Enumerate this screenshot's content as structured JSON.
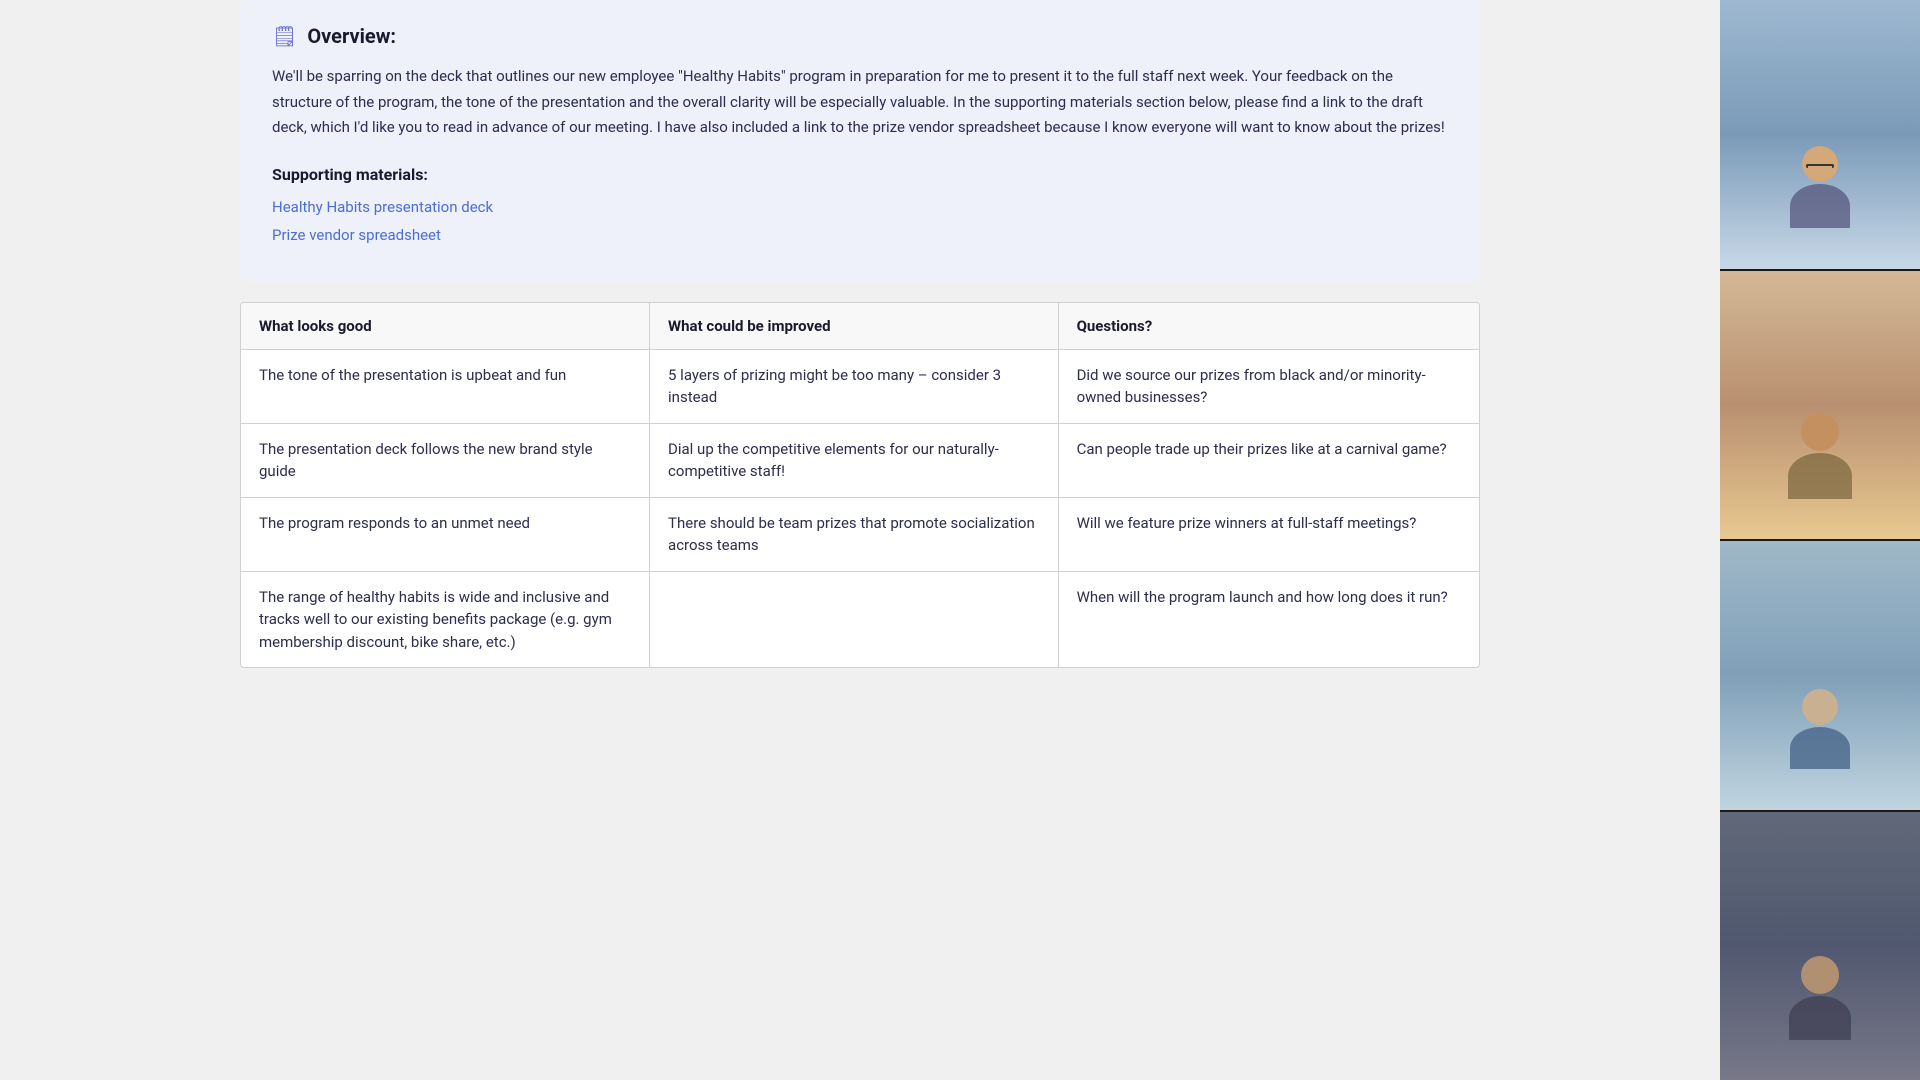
{
  "overview": {
    "icon": "📋",
    "title": "Overview:",
    "body": "We'll be sparring on the deck that outlines our new employee \"Healthy Habits\" program in preparation for me to present it to the full staff next week. Your feedback on the structure of the program, the tone of the presentation and the overall clarity will be especially valuable. In the supporting materials section below, please find a link to the draft deck, which I'd like you to read in advance of our meeting. I have also included a link to the prize vendor spreadsheet because I know everyone will want to know about the prizes!",
    "supporting_title": "Supporting materials:",
    "links": [
      {
        "label": "Healthy Habits presentation deck",
        "href": "#"
      },
      {
        "label": "Prize vendor spreadsheet",
        "href": "#"
      }
    ]
  },
  "table": {
    "headers": [
      "What looks good",
      "What could be improved",
      "Questions?"
    ],
    "rows": [
      {
        "good": "The tone of the presentation is upbeat and fun",
        "improve": "5 layers of prizing might be too many – consider 3 instead",
        "questions": "Did we source our prizes from black and/or minority-owned businesses?"
      },
      {
        "good": "The presentation deck follows the new brand style guide",
        "improve": "Dial up the competitive elements for our naturally-competitive staff!",
        "questions": "Can people trade up their prizes like at a carnival game?"
      },
      {
        "good": "The program responds to an unmet need",
        "improve": "There should be team prizes that promote socialization across teams",
        "questions": "Will we feature prize winners at full-staff meetings?"
      },
      {
        "good": "The range of healthy habits is wide and inclusive and tracks well to our existing benefits package (e.g. gym membership discount, bike share, etc.)",
        "improve": "",
        "questions": "When will the program launch and how long does it run?"
      }
    ]
  },
  "video_panel": {
    "participants": [
      {
        "id": 1,
        "name": ""
      },
      {
        "id": 2,
        "name": ""
      },
      {
        "id": 3,
        "name": ""
      },
      {
        "id": 4,
        "name": ""
      }
    ]
  }
}
